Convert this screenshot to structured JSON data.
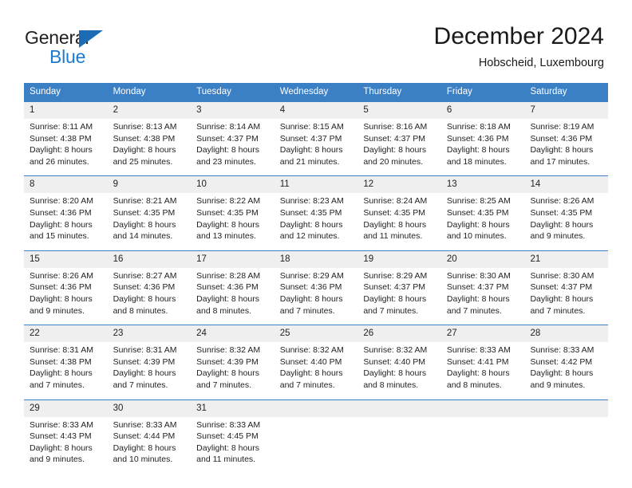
{
  "brand": {
    "name_top": "General",
    "name_bottom": "Blue",
    "accent_color": "#1b7bd0",
    "triangle_color": "#1b6cb5"
  },
  "header": {
    "title": "December 2024",
    "subtitle": "Hobscheid, Luxembourg"
  },
  "theme": {
    "header_row_bg": "#3b7fc4",
    "header_row_text": "#ffffff",
    "date_band_bg": "#efefef",
    "cell_text": "#222222"
  },
  "weekdays": [
    "Sunday",
    "Monday",
    "Tuesday",
    "Wednesday",
    "Thursday",
    "Friday",
    "Saturday"
  ],
  "weeks": [
    [
      {
        "day": "1",
        "sunrise": "Sunrise: 8:11 AM",
        "sunset": "Sunset: 4:38 PM",
        "daylight1": "Daylight: 8 hours",
        "daylight2": "and 26 minutes."
      },
      {
        "day": "2",
        "sunrise": "Sunrise: 8:13 AM",
        "sunset": "Sunset: 4:38 PM",
        "daylight1": "Daylight: 8 hours",
        "daylight2": "and 25 minutes."
      },
      {
        "day": "3",
        "sunrise": "Sunrise: 8:14 AM",
        "sunset": "Sunset: 4:37 PM",
        "daylight1": "Daylight: 8 hours",
        "daylight2": "and 23 minutes."
      },
      {
        "day": "4",
        "sunrise": "Sunrise: 8:15 AM",
        "sunset": "Sunset: 4:37 PM",
        "daylight1": "Daylight: 8 hours",
        "daylight2": "and 21 minutes."
      },
      {
        "day": "5",
        "sunrise": "Sunrise: 8:16 AM",
        "sunset": "Sunset: 4:37 PM",
        "daylight1": "Daylight: 8 hours",
        "daylight2": "and 20 minutes."
      },
      {
        "day": "6",
        "sunrise": "Sunrise: 8:18 AM",
        "sunset": "Sunset: 4:36 PM",
        "daylight1": "Daylight: 8 hours",
        "daylight2": "and 18 minutes."
      },
      {
        "day": "7",
        "sunrise": "Sunrise: 8:19 AM",
        "sunset": "Sunset: 4:36 PM",
        "daylight1": "Daylight: 8 hours",
        "daylight2": "and 17 minutes."
      }
    ],
    [
      {
        "day": "8",
        "sunrise": "Sunrise: 8:20 AM",
        "sunset": "Sunset: 4:36 PM",
        "daylight1": "Daylight: 8 hours",
        "daylight2": "and 15 minutes."
      },
      {
        "day": "9",
        "sunrise": "Sunrise: 8:21 AM",
        "sunset": "Sunset: 4:35 PM",
        "daylight1": "Daylight: 8 hours",
        "daylight2": "and 14 minutes."
      },
      {
        "day": "10",
        "sunrise": "Sunrise: 8:22 AM",
        "sunset": "Sunset: 4:35 PM",
        "daylight1": "Daylight: 8 hours",
        "daylight2": "and 13 minutes."
      },
      {
        "day": "11",
        "sunrise": "Sunrise: 8:23 AM",
        "sunset": "Sunset: 4:35 PM",
        "daylight1": "Daylight: 8 hours",
        "daylight2": "and 12 minutes."
      },
      {
        "day": "12",
        "sunrise": "Sunrise: 8:24 AM",
        "sunset": "Sunset: 4:35 PM",
        "daylight1": "Daylight: 8 hours",
        "daylight2": "and 11 minutes."
      },
      {
        "day": "13",
        "sunrise": "Sunrise: 8:25 AM",
        "sunset": "Sunset: 4:35 PM",
        "daylight1": "Daylight: 8 hours",
        "daylight2": "and 10 minutes."
      },
      {
        "day": "14",
        "sunrise": "Sunrise: 8:26 AM",
        "sunset": "Sunset: 4:35 PM",
        "daylight1": "Daylight: 8 hours",
        "daylight2": "and 9 minutes."
      }
    ],
    [
      {
        "day": "15",
        "sunrise": "Sunrise: 8:26 AM",
        "sunset": "Sunset: 4:36 PM",
        "daylight1": "Daylight: 8 hours",
        "daylight2": "and 9 minutes."
      },
      {
        "day": "16",
        "sunrise": "Sunrise: 8:27 AM",
        "sunset": "Sunset: 4:36 PM",
        "daylight1": "Daylight: 8 hours",
        "daylight2": "and 8 minutes."
      },
      {
        "day": "17",
        "sunrise": "Sunrise: 8:28 AM",
        "sunset": "Sunset: 4:36 PM",
        "daylight1": "Daylight: 8 hours",
        "daylight2": "and 8 minutes."
      },
      {
        "day": "18",
        "sunrise": "Sunrise: 8:29 AM",
        "sunset": "Sunset: 4:36 PM",
        "daylight1": "Daylight: 8 hours",
        "daylight2": "and 7 minutes."
      },
      {
        "day": "19",
        "sunrise": "Sunrise: 8:29 AM",
        "sunset": "Sunset: 4:37 PM",
        "daylight1": "Daylight: 8 hours",
        "daylight2": "and 7 minutes."
      },
      {
        "day": "20",
        "sunrise": "Sunrise: 8:30 AM",
        "sunset": "Sunset: 4:37 PM",
        "daylight1": "Daylight: 8 hours",
        "daylight2": "and 7 minutes."
      },
      {
        "day": "21",
        "sunrise": "Sunrise: 8:30 AM",
        "sunset": "Sunset: 4:37 PM",
        "daylight1": "Daylight: 8 hours",
        "daylight2": "and 7 minutes."
      }
    ],
    [
      {
        "day": "22",
        "sunrise": "Sunrise: 8:31 AM",
        "sunset": "Sunset: 4:38 PM",
        "daylight1": "Daylight: 8 hours",
        "daylight2": "and 7 minutes."
      },
      {
        "day": "23",
        "sunrise": "Sunrise: 8:31 AM",
        "sunset": "Sunset: 4:39 PM",
        "daylight1": "Daylight: 8 hours",
        "daylight2": "and 7 minutes."
      },
      {
        "day": "24",
        "sunrise": "Sunrise: 8:32 AM",
        "sunset": "Sunset: 4:39 PM",
        "daylight1": "Daylight: 8 hours",
        "daylight2": "and 7 minutes."
      },
      {
        "day": "25",
        "sunrise": "Sunrise: 8:32 AM",
        "sunset": "Sunset: 4:40 PM",
        "daylight1": "Daylight: 8 hours",
        "daylight2": "and 7 minutes."
      },
      {
        "day": "26",
        "sunrise": "Sunrise: 8:32 AM",
        "sunset": "Sunset: 4:40 PM",
        "daylight1": "Daylight: 8 hours",
        "daylight2": "and 8 minutes."
      },
      {
        "day": "27",
        "sunrise": "Sunrise: 8:33 AM",
        "sunset": "Sunset: 4:41 PM",
        "daylight1": "Daylight: 8 hours",
        "daylight2": "and 8 minutes."
      },
      {
        "day": "28",
        "sunrise": "Sunrise: 8:33 AM",
        "sunset": "Sunset: 4:42 PM",
        "daylight1": "Daylight: 8 hours",
        "daylight2": "and 9 minutes."
      }
    ],
    [
      {
        "day": "29",
        "sunrise": "Sunrise: 8:33 AM",
        "sunset": "Sunset: 4:43 PM",
        "daylight1": "Daylight: 8 hours",
        "daylight2": "and 9 minutes."
      },
      {
        "day": "30",
        "sunrise": "Sunrise: 8:33 AM",
        "sunset": "Sunset: 4:44 PM",
        "daylight1": "Daylight: 8 hours",
        "daylight2": "and 10 minutes."
      },
      {
        "day": "31",
        "sunrise": "Sunrise: 8:33 AM",
        "sunset": "Sunset: 4:45 PM",
        "daylight1": "Daylight: 8 hours",
        "daylight2": "and 11 minutes."
      },
      {
        "day": "",
        "sunrise": "",
        "sunset": "",
        "daylight1": "",
        "daylight2": ""
      },
      {
        "day": "",
        "sunrise": "",
        "sunset": "",
        "daylight1": "",
        "daylight2": ""
      },
      {
        "day": "",
        "sunrise": "",
        "sunset": "",
        "daylight1": "",
        "daylight2": ""
      },
      {
        "day": "",
        "sunrise": "",
        "sunset": "",
        "daylight1": "",
        "daylight2": ""
      }
    ]
  ]
}
